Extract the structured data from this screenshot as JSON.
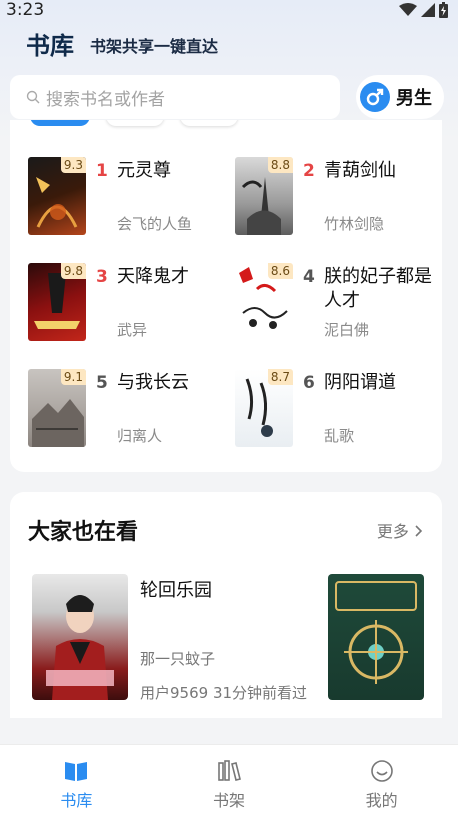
{
  "status_bar": {
    "time": "3:23"
  },
  "header": {
    "title": "书库",
    "slogan": "书架共享一键直达"
  },
  "search": {
    "placeholder": "搜索书名或作者"
  },
  "gender": {
    "label": "男生"
  },
  "rank_list": [
    {
      "rank": "1",
      "score": "9.3",
      "title": "元灵尊",
      "author": "会飞的人鱼"
    },
    {
      "rank": "2",
      "score": "8.8",
      "title": "青葫剑仙",
      "author": "竹林剑隐"
    },
    {
      "rank": "3",
      "score": "9.8",
      "title": "天降鬼才",
      "author": "武异"
    },
    {
      "rank": "4",
      "score": "8.6",
      "title": "朕的妃子都是人才",
      "author": "泥白佛"
    },
    {
      "rank": "5",
      "score": "9.1",
      "title": "与我长云",
      "author": "归离人"
    },
    {
      "rank": "6",
      "score": "8.7",
      "title": "阴阳谓道",
      "author": "乱歌"
    }
  ],
  "reading": {
    "title": "大家也在看",
    "more": "更多",
    "book": {
      "title": "轮回乐园",
      "author": "那一只蚊子",
      "meta": "用户9569 31分钟前看过"
    }
  },
  "bottom_nav": [
    {
      "label": "书库",
      "icon": "book-open-icon",
      "active": true
    },
    {
      "label": "书架",
      "icon": "bookshelf-icon",
      "active": false
    },
    {
      "label": "我的",
      "icon": "smiley-icon",
      "active": false
    }
  ],
  "colors": {
    "accent": "#2a8cf0",
    "rank_top": "#e54545",
    "score_bg": "#fde7c2"
  }
}
